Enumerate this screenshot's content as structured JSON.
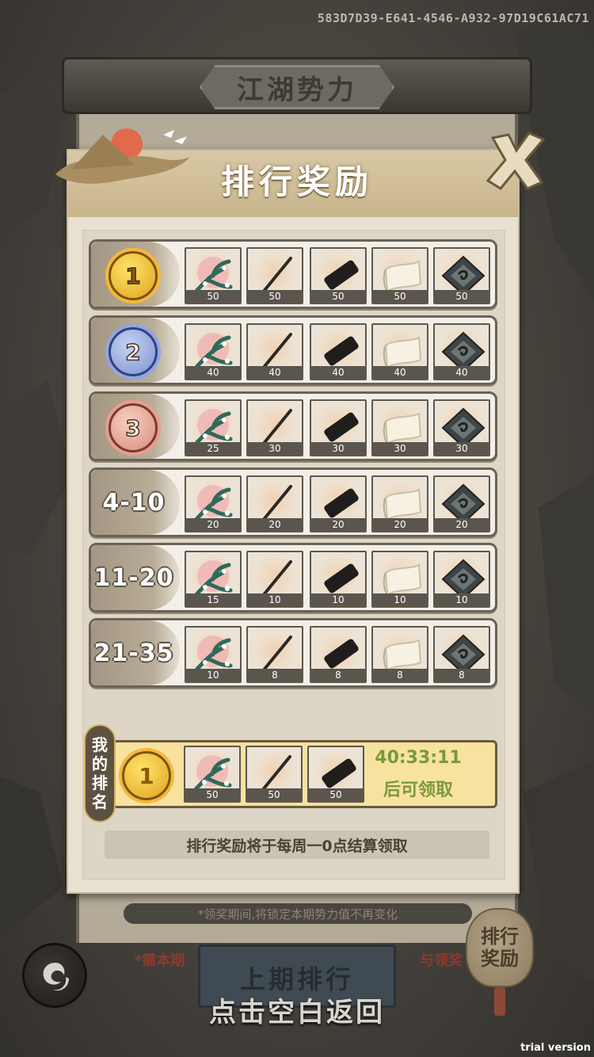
{
  "device_id": "583D7D39-E641-4546-A932-97D19C61AC71",
  "back_panel": {
    "title": "江湖势力",
    "note": "*领奖期间,将锁定本期势力值不再变化",
    "red_left": "*需本期",
    "red_right": "与领奖",
    "button_label": "上期排行"
  },
  "tap_return": "点击空白返回",
  "side_bag_label": "排行奖励",
  "watermark": "trial version",
  "panel": {
    "title": "排行奖励",
    "rows": [
      {
        "rank": "1",
        "medal": "gold",
        "counts": [
          "50",
          "50",
          "50",
          "50",
          "50"
        ]
      },
      {
        "rank": "2",
        "medal": "silver",
        "counts": [
          "40",
          "40",
          "40",
          "40",
          "40"
        ]
      },
      {
        "rank": "3",
        "medal": "bronze",
        "counts": [
          "25",
          "30",
          "30",
          "30",
          "30"
        ]
      },
      {
        "rank": "4-10",
        "medal": "",
        "counts": [
          "20",
          "20",
          "20",
          "20",
          "20"
        ]
      },
      {
        "rank": "11-20",
        "medal": "",
        "counts": [
          "15",
          "10",
          "10",
          "10",
          "10"
        ]
      },
      {
        "rank": "21-35",
        "medal": "",
        "counts": [
          "10",
          "8",
          "8",
          "8",
          "8"
        ]
      }
    ],
    "items": [
      "plum-branch-icon",
      "brush-icon",
      "ink-stick-icon",
      "paper-scroll-icon",
      "ink-stone-icon"
    ],
    "my_rank": {
      "tag": [
        "我",
        "的",
        "排",
        "名"
      ],
      "rank": "1",
      "counts": [
        "50",
        "50",
        "50"
      ],
      "timer": "40:33:11",
      "timer_suffix": "后可领取"
    },
    "settle_note": "排行奖励将于每周一0点结算领取"
  }
}
